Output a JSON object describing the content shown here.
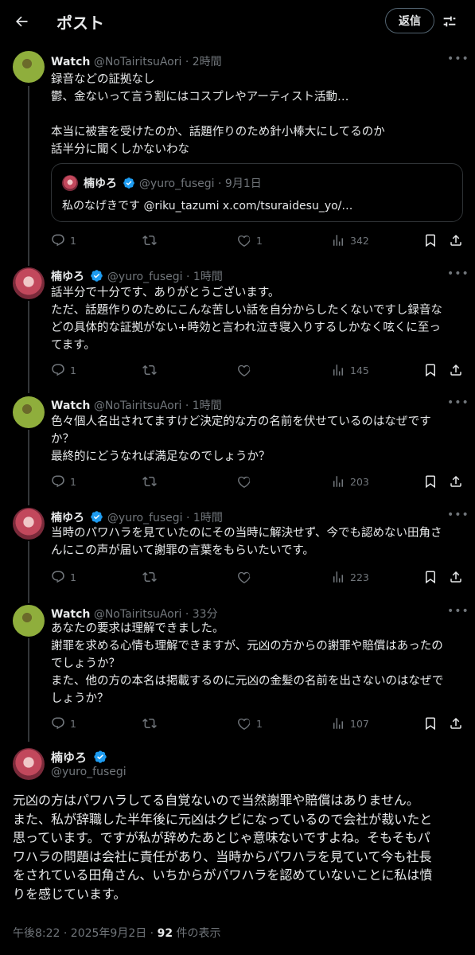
{
  "header": {
    "title": "ポスト",
    "reply_button": "返信"
  },
  "posts": [
    {
      "name": "Watch",
      "handle": "@NoTairitsuAori",
      "time": "· 2時間",
      "verified": false,
      "lines": [
        "録音などの証拠なし",
        "鬱、金ないって言う割にはコスプレやアーティスト活動…",
        "",
        "本当に被害を受けたのか、話題作りのため針小棒大にしてるのか",
        "話半分に聞くしかないわな"
      ],
      "quote": {
        "name": "楠ゆろ",
        "handle": "@yuro_fusegi",
        "time": "· 9月1日",
        "text": "私のなげきです @riku_tazumi x.com/tsuraidesu_yo/…"
      },
      "replies": "1",
      "reposts": "",
      "likes": "1",
      "views": "342"
    },
    {
      "name": "楠ゆろ",
      "handle": "@yuro_fusegi",
      "time": "· 1時間",
      "verified": true,
      "lines": [
        "話半分で十分です、ありがとうございます。",
        "ただ、話題作りのためにこんな苦しい話を自分からしたくないですし録音な",
        "どの具体的な証拠がない+時効と言われ泣き寝入りするしかなく呟くに至っ",
        "てます。"
      ],
      "replies": "1",
      "reposts": "",
      "likes": "",
      "views": "145"
    },
    {
      "name": "Watch",
      "handle": "@NoTairitsuAori",
      "time": "· 1時間",
      "verified": false,
      "lines": [
        "色々個人名出されてますけど決定的な方の名前を伏せているのはなぜです",
        "か？",
        "最終的にどうなれば満足なのでしょうか？"
      ],
      "replies": "1",
      "reposts": "",
      "likes": "",
      "views": "203"
    },
    {
      "name": "楠ゆろ",
      "handle": "@yuro_fusegi",
      "time": "· 1時間",
      "verified": true,
      "lines": [
        "当時のパワハラを見ていたのにその当時に解決せず、今でも認めない田角さ",
        "んにこの声が届いて謝罪の言葉をもらいたいです。"
      ],
      "replies": "1",
      "reposts": "",
      "likes": "",
      "views": "223"
    },
    {
      "name": "Watch",
      "handle": "@NoTairitsuAori",
      "time": "· 33分",
      "verified": false,
      "lines": [
        "あなたの要求は理解できました。",
        "謝罪を求める心情も理解できますが、元凶の方からの謝罪や賠償はあったの",
        "でしょうか？",
        "また、他の方の本名は掲載するのに元凶の金髪の名前を出さないのはなぜで",
        "しょうか？"
      ],
      "replies": "1",
      "reposts": "",
      "likes": "1",
      "views": "107"
    }
  ],
  "main_post": {
    "name": "楠ゆろ",
    "handle": "@yuro_fusegi",
    "lines": [
      "元凶の方はパワハラしてる自覚ないので当然謝罪や賠償はありません。",
      "また、私が辞職した半年後に元凶はクビになっているので会社が裁いたと",
      "思っています。ですが私が辞めたあとじゃ意味ないですよね。そもそもパ",
      "ワハラの問題は会社に責任があり、当時からパワハラを見ていて今も社長",
      "をされている田角さん、いちからがパワハラを認めていないことに私は憤",
      "りを感じています。"
    ],
    "timestamp": "午後8:22 · 2025年9月2日 · ",
    "views_count": "92",
    "views_suffix": " 件の表示"
  },
  "colors": {
    "background": "#000000",
    "text": "#e7e9ea",
    "muted": "#71767b",
    "verified": "#1d9bf0",
    "border": "#2f3336"
  }
}
